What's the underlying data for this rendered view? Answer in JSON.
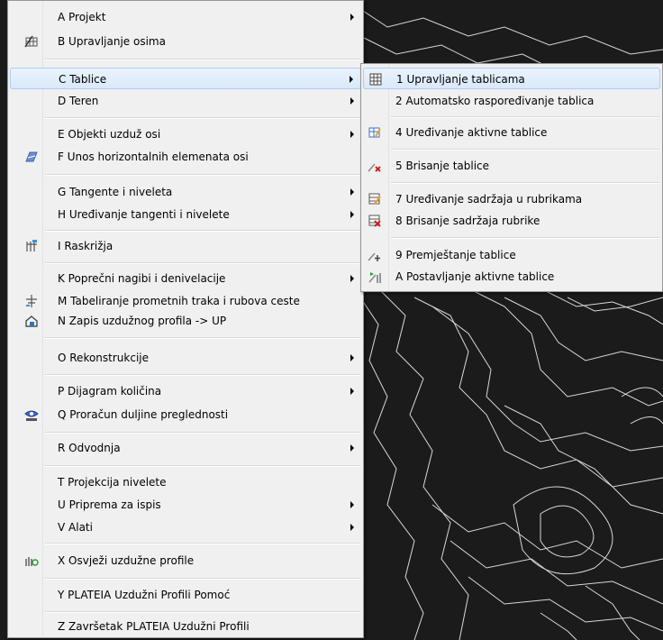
{
  "main_menu": {
    "items": [
      {
        "label": "A Projekt",
        "arrow": true,
        "icon": ""
      },
      {
        "label": "B Upravljanje osima",
        "arrow": false,
        "icon": "axis-management-icon"
      },
      {
        "label": "C Tablice",
        "arrow": true,
        "icon": "",
        "highlighted": true
      },
      {
        "label": "D Teren",
        "arrow": true,
        "icon": ""
      },
      {
        "label": "E Objekti uzduž osi",
        "arrow": true,
        "icon": ""
      },
      {
        "label": "F Unos horizontalnih elemenata osi",
        "arrow": false,
        "icon": "horizontal-elements-icon"
      },
      {
        "label": "G Tangente i niveleta",
        "arrow": true,
        "icon": ""
      },
      {
        "label": "H Uređivanje tangenti i nivelete",
        "arrow": true,
        "icon": ""
      },
      {
        "label": "I Raskrižja",
        "arrow": false,
        "icon": "intersection-icon"
      },
      {
        "label": "K Poprečni nagibi i denivelacije",
        "arrow": true,
        "icon": ""
      },
      {
        "label": "M Tabeliranje prometnih traka i rubova ceste",
        "arrow": false,
        "icon": "lane-table-icon"
      },
      {
        "label": "N Zapis uzdužnog profila -> UP",
        "arrow": false,
        "icon": "profile-record-icon"
      },
      {
        "label": "O Rekonstrukcije",
        "arrow": true,
        "icon": ""
      },
      {
        "label": "P Dijagram količina",
        "arrow": true,
        "icon": ""
      },
      {
        "label": "Q Proračun duljine preglednosti",
        "arrow": false,
        "icon": "visibility-length-icon"
      },
      {
        "label": "R Odvodnja",
        "arrow": true,
        "icon": ""
      },
      {
        "label": "T Projekcija nivelete",
        "arrow": false,
        "icon": ""
      },
      {
        "label": "U Priprema za ispis",
        "arrow": true,
        "icon": ""
      },
      {
        "label": "V Alati",
        "arrow": true,
        "icon": ""
      },
      {
        "label": "X Osvježi uzdužne profile",
        "arrow": false,
        "icon": "refresh-profiles-icon"
      },
      {
        "label": "Y PLATEIA Uzdužni Profili Pomoć",
        "arrow": false,
        "icon": ""
      },
      {
        "label": "Z Završetak PLATEIA Uzdužni Profili",
        "arrow": false,
        "icon": ""
      }
    ]
  },
  "submenu": {
    "items": [
      {
        "label": "1 Upravljanje tablicama",
        "icon": "table-grid-icon",
        "highlighted": true
      },
      {
        "label": "2 Automatsko raspoređivanje tablica",
        "icon": ""
      },
      {
        "label": "4 Uređivanje aktivne tablice",
        "icon": "edit-table-icon"
      },
      {
        "label": "5 Brisanje tablice",
        "icon": "delete-table-icon"
      },
      {
        "label": "7 Uređivanje sadržaja u rubrikama",
        "icon": "edit-cells-icon"
      },
      {
        "label": "8 Brisanje sadržaja rubrike",
        "icon": "delete-cells-icon"
      },
      {
        "label": "9 Premještanje tablice",
        "icon": "move-table-icon"
      },
      {
        "label": "A Postavljanje aktivne tablice",
        "icon": "set-active-table-icon"
      }
    ]
  },
  "colors": {
    "menu_bg": "#f0f0f0",
    "highlight": "#d9e9fa",
    "canvas_bg": "#1b1b1b",
    "contour": "#d8d8d8"
  }
}
